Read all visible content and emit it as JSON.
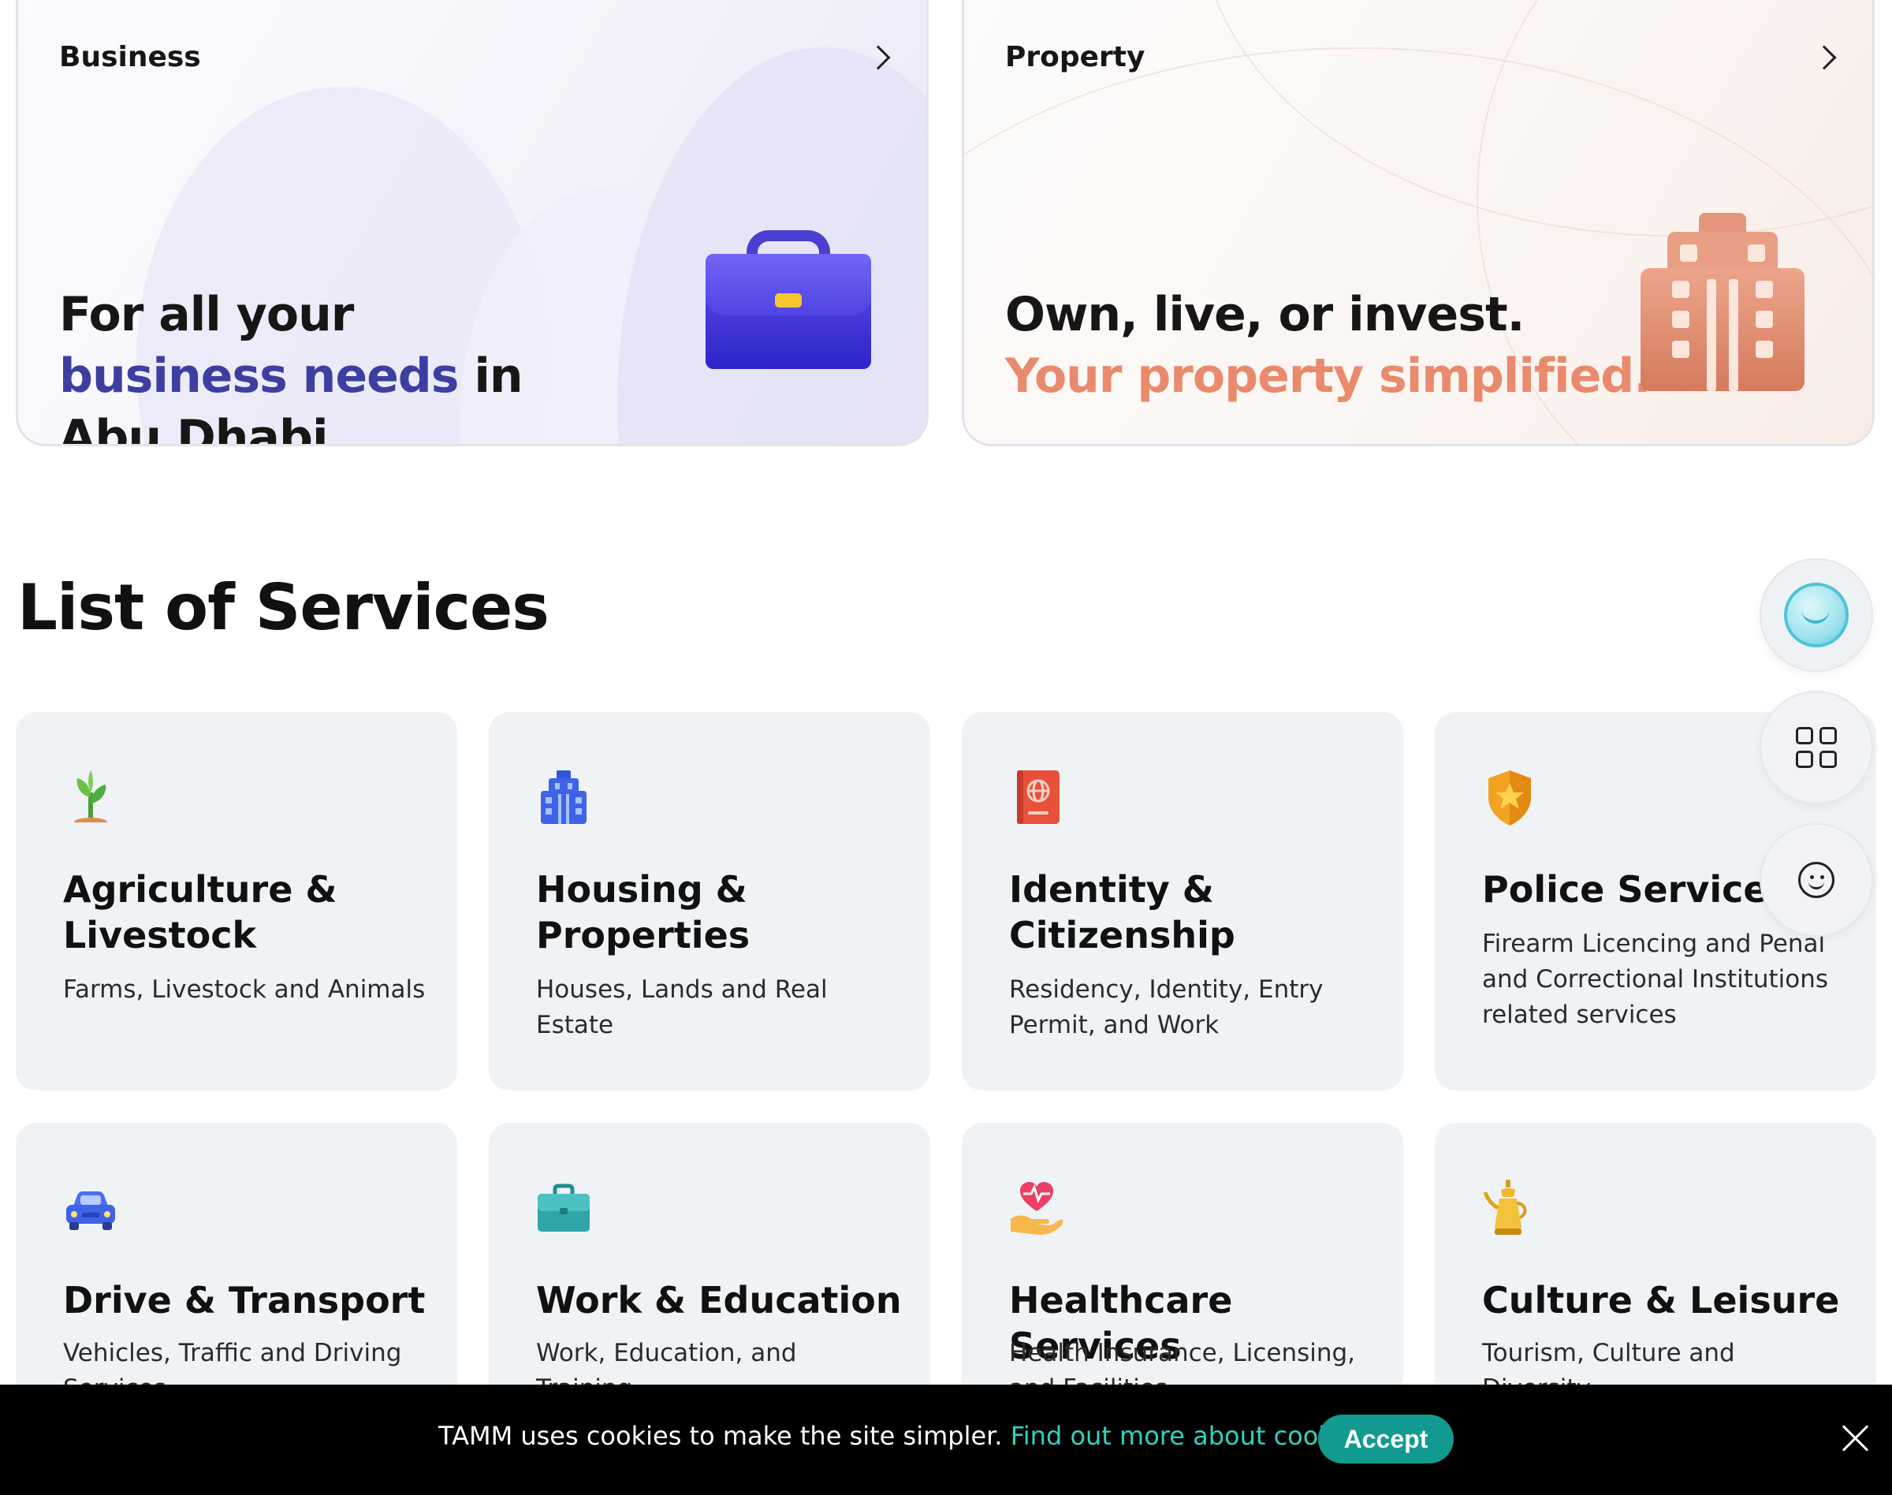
{
  "hero_cards": {
    "business": {
      "label": "Business",
      "headline_part1": "For all your ",
      "headline_accent": "business needs",
      "headline_part2": " in Abu Dhabi."
    },
    "property": {
      "label": "Property",
      "headline_line1": "Own, live, or invest.",
      "headline_line2": "Your property simplified."
    }
  },
  "services_section": {
    "title": "List of Services",
    "items": [
      {
        "icon": "sprout-icon",
        "title": "Agriculture & Livestock",
        "description": "Farms, Livestock and Animals"
      },
      {
        "icon": "building-icon",
        "title": "Housing & Properties",
        "description": "Houses, Lands and Real Estate"
      },
      {
        "icon": "passport-icon",
        "title": "Identity & Citizenship",
        "description": "Residency, Identity, Entry Permit, and Work"
      },
      {
        "icon": "police-badge-icon",
        "title": "Police Services",
        "description": "Firearm Licencing and Penal and Correctional Institutions related services"
      },
      {
        "icon": "car-icon",
        "title": "Drive & Transport",
        "description": "Vehicles, Traffic and Driving Services"
      },
      {
        "icon": "briefcase-icon",
        "title": "Work & Education",
        "description": "Work, Education, and Training"
      },
      {
        "icon": "heart-hand-icon",
        "title": "Healthcare Services",
        "description": "Health Insurance, Licensing, and Facilities"
      },
      {
        "icon": "coffee-pot-icon",
        "title": "Culture & Leisure",
        "description": "Tourism, Culture and Diversity"
      }
    ]
  },
  "cookie_banner": {
    "message": "TAMM uses cookies to make the site simpler. ",
    "link_text": "Find out more about cookies.",
    "accept_label": "Accept"
  },
  "colors": {
    "business_accent": "#3d3fa0",
    "property_accent": "#e98a6c",
    "accept_button": "#119a8f",
    "cookie_link": "#2fd2c0"
  }
}
